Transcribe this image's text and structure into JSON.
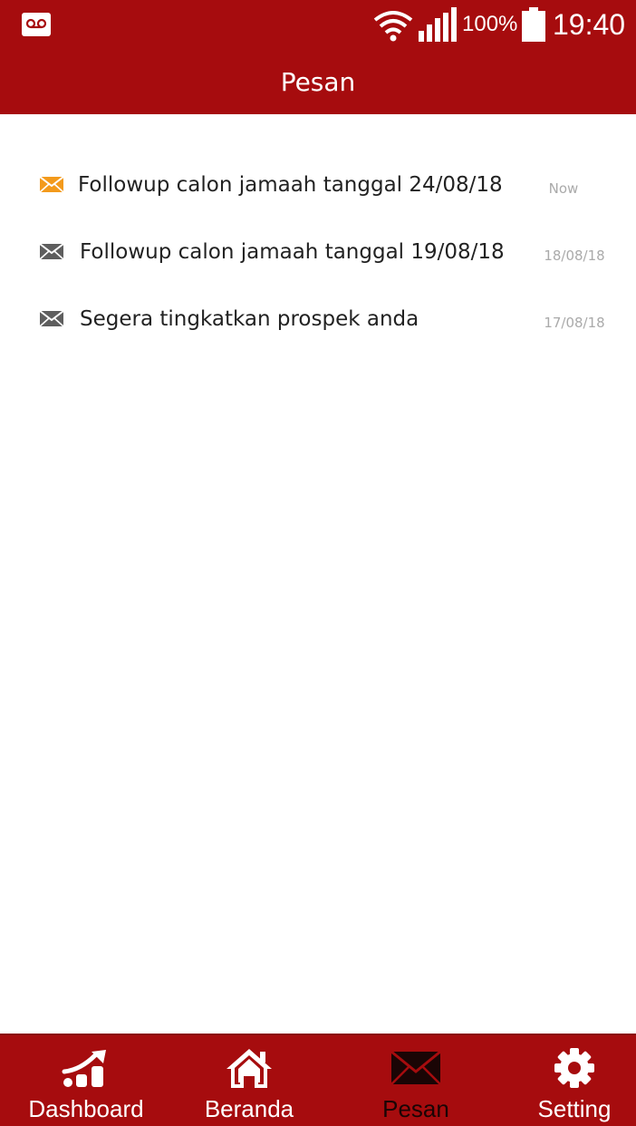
{
  "status_bar": {
    "battery_text": "100%",
    "time": "19:40",
    "icons": [
      "voicemail-icon",
      "wifi-icon",
      "signal-icon",
      "battery-icon"
    ]
  },
  "app_bar": {
    "title": "Pesan"
  },
  "messages": [
    {
      "subject": "Followup calon jamaah tanggal 24/08/18",
      "date": "Now",
      "unread": true,
      "icon": "envelope-icon",
      "icon_color": "#f39a1c"
    },
    {
      "subject": "Followup calon jamaah tanggal 19/08/18",
      "date": "18/08/18",
      "unread": false,
      "icon": "envelope-icon",
      "icon_color": "#5e5e5e"
    },
    {
      "subject": "Segera tingkatkan prospek anda",
      "date": "17/08/18",
      "unread": false,
      "icon": "envelope-icon",
      "icon_color": "#5e5e5e"
    }
  ],
  "bottom_nav": {
    "items": [
      {
        "label": "Dashboard",
        "icon": "chart-icon",
        "active": false
      },
      {
        "label": "Beranda",
        "icon": "home-icon",
        "active": false
      },
      {
        "label": "Pesan",
        "icon": "envelope-icon",
        "active": true
      },
      {
        "label": "Setting",
        "icon": "gear-icon",
        "active": false
      }
    ]
  },
  "colors": {
    "primary": "#a60c0e",
    "unread_accent": "#f39a1c",
    "text": "#222222",
    "muted": "#aaaaaa"
  }
}
